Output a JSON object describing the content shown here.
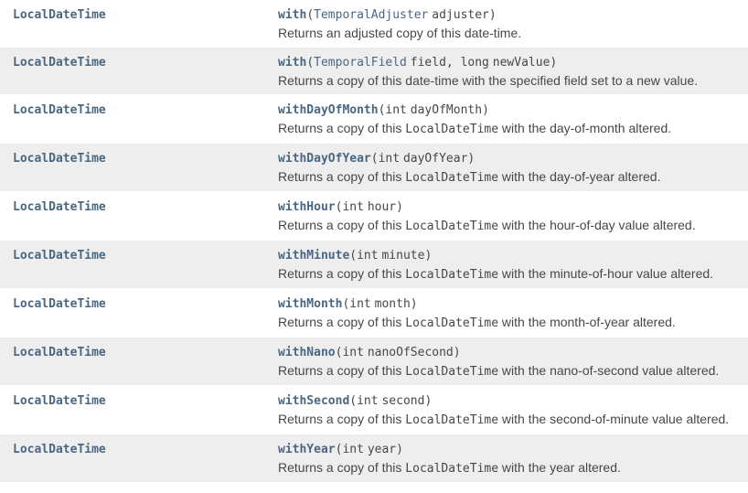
{
  "returnTypeLabel": "LocalDateTime",
  "methods": [
    {
      "name": "with",
      "params": [
        {
          "type": "TemporalAdjuster",
          "typeIsLink": true,
          "name": "adjuster"
        }
      ],
      "desc_pre": "Returns an adjusted copy of this date-time.",
      "desc_code": "",
      "desc_post": ""
    },
    {
      "name": "with",
      "params": [
        {
          "type": "TemporalField",
          "typeIsLink": true,
          "name": "field"
        },
        {
          "type": "long",
          "typeIsLink": false,
          "name": "newValue"
        }
      ],
      "desc_pre": "Returns a copy of this date-time with the specified field set to a new value.",
      "desc_code": "",
      "desc_post": ""
    },
    {
      "name": "withDayOfMonth",
      "params": [
        {
          "type": "int",
          "typeIsLink": false,
          "name": "dayOfMonth"
        }
      ],
      "desc_pre": "Returns a copy of this ",
      "desc_code": "LocalDateTime",
      "desc_post": " with the day-of-month altered."
    },
    {
      "name": "withDayOfYear",
      "params": [
        {
          "type": "int",
          "typeIsLink": false,
          "name": "dayOfYear"
        }
      ],
      "desc_pre": "Returns a copy of this ",
      "desc_code": "LocalDateTime",
      "desc_post": " with the day-of-year altered."
    },
    {
      "name": "withHour",
      "params": [
        {
          "type": "int",
          "typeIsLink": false,
          "name": "hour"
        }
      ],
      "desc_pre": "Returns a copy of this ",
      "desc_code": "LocalDateTime",
      "desc_post": " with the hour-of-day value altered."
    },
    {
      "name": "withMinute",
      "params": [
        {
          "type": "int",
          "typeIsLink": false,
          "name": "minute"
        }
      ],
      "desc_pre": "Returns a copy of this ",
      "desc_code": "LocalDateTime",
      "desc_post": " with the minute-of-hour value altered."
    },
    {
      "name": "withMonth",
      "params": [
        {
          "type": "int",
          "typeIsLink": false,
          "name": "month"
        }
      ],
      "desc_pre": "Returns a copy of this ",
      "desc_code": "LocalDateTime",
      "desc_post": " with the month-of-year altered."
    },
    {
      "name": "withNano",
      "params": [
        {
          "type": "int",
          "typeIsLink": false,
          "name": "nanoOfSecond"
        }
      ],
      "desc_pre": "Returns a copy of this ",
      "desc_code": "LocalDateTime",
      "desc_post": " with the nano-of-second value altered."
    },
    {
      "name": "withSecond",
      "params": [
        {
          "type": "int",
          "typeIsLink": false,
          "name": "second"
        }
      ],
      "desc_pre": "Returns a copy of this ",
      "desc_code": "LocalDateTime",
      "desc_post": " with the second-of-minute value altered."
    },
    {
      "name": "withYear",
      "params": [
        {
          "type": "int",
          "typeIsLink": false,
          "name": "year"
        }
      ],
      "desc_pre": "Returns a copy of this ",
      "desc_code": "LocalDateTime",
      "desc_post": " with the year altered."
    }
  ]
}
